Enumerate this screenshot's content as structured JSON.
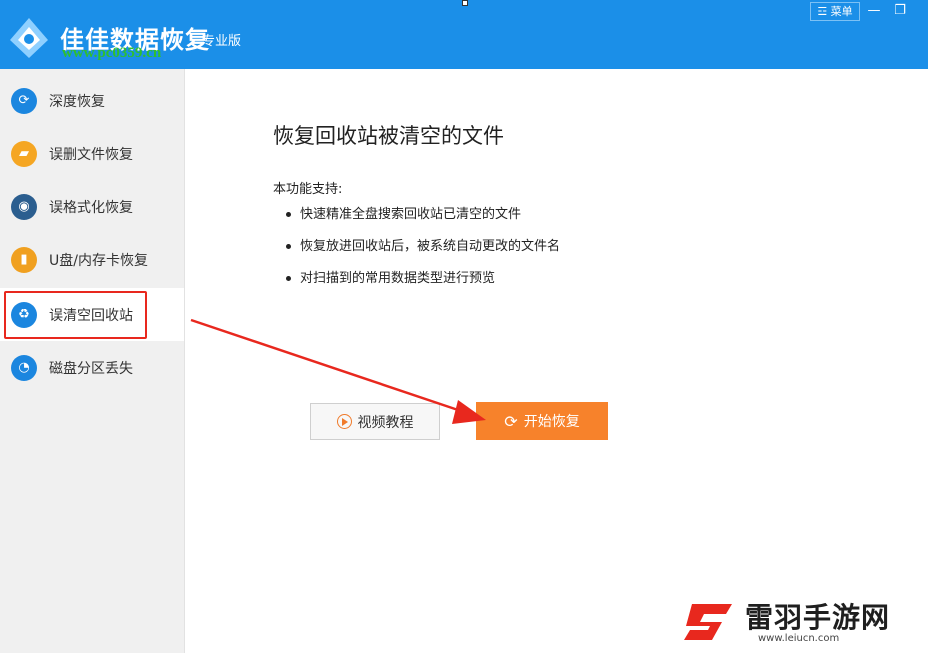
{
  "titlebar": {
    "app_title": "佳佳数据恢复",
    "edition": "专业版",
    "watermark_url": "www.pc0359.cn",
    "menu_label": "☲ 菜单",
    "minimize": "—",
    "restore": "❐"
  },
  "sidebar": {
    "items": [
      {
        "label": "深度恢复",
        "icon": "refresh-icon"
      },
      {
        "label": "误删文件恢复",
        "icon": "folder-icon"
      },
      {
        "label": "误格式化恢复",
        "icon": "disk-icon"
      },
      {
        "label": "U盘/内存卡恢复",
        "icon": "usb-icon"
      },
      {
        "label": "误清空回收站",
        "icon": "recycle-bin-icon"
      },
      {
        "label": "磁盘分区丢失",
        "icon": "pie-chart-icon"
      }
    ],
    "active_index": 4
  },
  "content": {
    "title": "恢复回收站被清空的文件",
    "support_label": "本功能支持:",
    "features": [
      "快速精准全盘搜索回收站已清空的文件",
      "恢复放进回收站后，被系统自动更改的文件名",
      "对扫描到的常用数据类型进行预览"
    ],
    "video_button": "视频教程",
    "start_button": "开始恢复"
  },
  "watermark": {
    "name": "雷羽手游网",
    "url": "www.leiucn.com"
  },
  "colors": {
    "titlebar": "#1b8fe8",
    "accent_orange": "#f7822b",
    "annotation_red": "#e8281e"
  }
}
